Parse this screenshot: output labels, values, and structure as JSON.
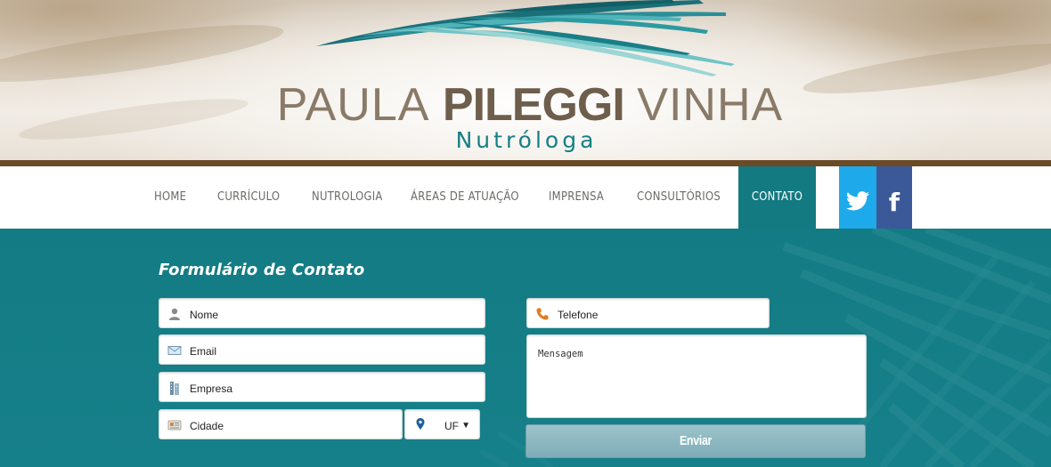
{
  "header": {
    "name_part1": "PAULA",
    "name_part2": "PILEGGI",
    "name_part3": "VINHA",
    "subtitle": "Nutróloga"
  },
  "nav": {
    "items": [
      "HOME",
      "CURRÍCULO",
      "NUTROLOGIA",
      "ÁREAS DE ATUAÇÃO",
      "IMPRENSA",
      "CONSULTÓRIOS",
      "CONTATO"
    ],
    "active": "CONTATO",
    "social": {
      "twitter_icon": "twitter-icon",
      "facebook_label": "f"
    }
  },
  "form": {
    "title": "Formulário de Contato",
    "nome_placeholder": "Nome",
    "email_placeholder": "Email",
    "empresa_placeholder": "Empresa",
    "cidade_placeholder": "Cidade",
    "uf_value": "UF",
    "telefone_placeholder": "Telefone",
    "mensagem_placeholder": "Mensagem",
    "submit_label": "Enviar"
  },
  "colors": {
    "teal": "#137a82",
    "brown_bar": "#6b4a26",
    "twitter": "#1eaaea",
    "facebook": "#3b5998",
    "button": "#8fb8c1"
  }
}
